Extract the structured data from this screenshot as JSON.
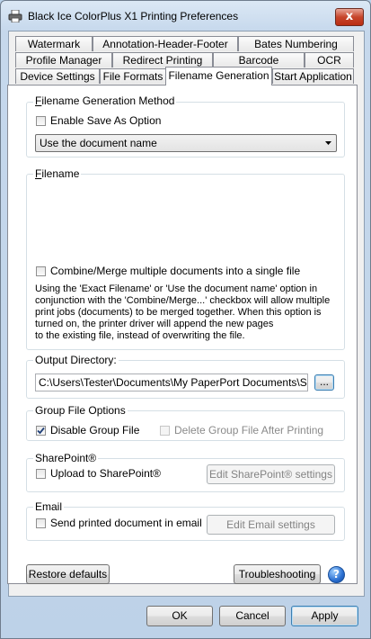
{
  "window": {
    "title": "Black Ice ColorPlus X1 Printing Preferences",
    "close_glyph": "x"
  },
  "tabs": {
    "row1": [
      "Watermark",
      "Annotation-Header-Footer",
      "Bates Numbering"
    ],
    "row2": [
      "Profile Manager",
      "Redirect Printing",
      "Barcode",
      "OCR"
    ],
    "row3": [
      "Device Settings",
      "File Formats",
      "Filename Generation",
      "Start Application"
    ],
    "active": "Filename Generation"
  },
  "filename_generation_method": {
    "title": "Filename Generation Method",
    "enable_save_as_label": "Enable Save As Option",
    "enable_save_as_checked": false,
    "method_selected": "Use the document name"
  },
  "filename": {
    "title": "Filename",
    "combine_label": "Combine/Merge multiple documents into a single file",
    "combine_checked": false,
    "note_lines": [
      "Using the 'Exact Filename' or 'Use the  document name' option in",
      "conjunction with the 'Combine/Merge...' checkbox will allow multiple",
      "print jobs (documents) to be merged together. When this option is",
      "turned on, the printer driver will append the new pages",
      "to the existing file, instead of overwriting the file."
    ]
  },
  "output_directory": {
    "title": "Output Directory:",
    "value": "C:\\Users\\Tester\\Documents\\My PaperPort Documents\\Sampl",
    "browse_label": "..."
  },
  "group_file_options": {
    "title": "Group File Options",
    "disable_group_file_label": "Disable Group File",
    "disable_group_file_checked": true,
    "delete_group_file_label": "Delete Group File After Printing",
    "delete_group_file_checked": false
  },
  "sharepoint": {
    "title": "SharePoint®",
    "upload_label": "Upload to SharePoint®",
    "upload_checked": false,
    "settings_button": "Edit SharePoint® settings"
  },
  "email": {
    "title": "Email",
    "send_label": "Send printed document in email",
    "send_checked": false,
    "settings_button": "Edit Email settings"
  },
  "footer": {
    "restore_defaults": "Restore defaults",
    "troubleshooting": "Troubleshooting",
    "help_glyph": "?"
  },
  "dialog_buttons": {
    "ok": "OK",
    "cancel": "Cancel",
    "apply": "Apply"
  },
  "colors": {
    "accent": "#3c7fb1",
    "help_icon": "#2a6fd1"
  }
}
